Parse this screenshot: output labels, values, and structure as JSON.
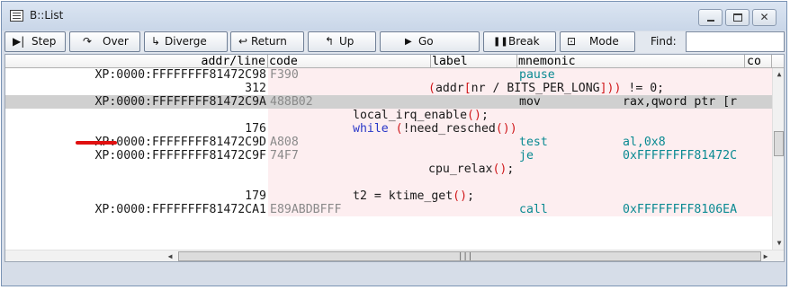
{
  "window": {
    "title": "B::List"
  },
  "toolbar": {
    "buttons": [
      {
        "icon": "▶|",
        "label": "Step"
      },
      {
        "icon": "↷",
        "label": "Over"
      },
      {
        "icon": "↳",
        "label": "Diverge"
      },
      {
        "icon": "↩",
        "label": "Return"
      },
      {
        "icon": "↰",
        "label": "Up"
      },
      {
        "icon": "▶",
        "label": "Go"
      },
      {
        "icon": "❚❚",
        "label": "Break"
      },
      {
        "icon": "⊡",
        "label": "Mode"
      }
    ],
    "find_label": "Find:",
    "find_value": ""
  },
  "columns": {
    "addr": "addr/line",
    "code": "code",
    "label": "label",
    "mnemonic": "mnemonic",
    "co": "co"
  },
  "rows": [
    {
      "type": "asm",
      "addr": "XP:0000:FFFFFFFF81472C98",
      "code": "F390",
      "mnemonic": "pause",
      "operands": ""
    },
    {
      "type": "src",
      "line": "312",
      "source": "(addr[nr / BITS_PER_LONG])) != 0;"
    },
    {
      "type": "asm",
      "addr": "XP:0000:FFFFFFFF81472C9A",
      "code": "488B02",
      "mnemonic": "mov",
      "operands": "rax,qword ptr [r",
      "selected": true
    },
    {
      "type": "src",
      "line": "",
      "source": "local_irq_enable();"
    },
    {
      "type": "src",
      "line": "176",
      "source": "while (!need_resched())"
    },
    {
      "type": "asm",
      "addr": "XP:0000:FFFFFFFF81472C9D",
      "code": "A808",
      "mnemonic": "test",
      "operands": "al,0x8"
    },
    {
      "type": "asm",
      "addr": "XP:0000:FFFFFFFF81472C9F",
      "code": "74F7",
      "mnemonic": "je",
      "operands": "0xFFFFFFFF81472C"
    },
    {
      "type": "src",
      "line": "",
      "source": "cpu_relax();"
    },
    {
      "type": "blank"
    },
    {
      "type": "src",
      "line": "179",
      "source": "t2 = ktime_get();"
    },
    {
      "type": "asm",
      "addr": "XP:0000:FFFFFFFF81472CA1",
      "code": "E89ABDBFFF",
      "mnemonic": "call",
      "operands": "0xFFFFFFFF8106EA"
    }
  ],
  "colors": {
    "source_blue": "#2a37c8",
    "mnemonic_teal": "#0a8a92",
    "selected_row": "#d0d0d0",
    "code_bg_pink": "#fdeef0",
    "annotation_red": "#e01010"
  }
}
